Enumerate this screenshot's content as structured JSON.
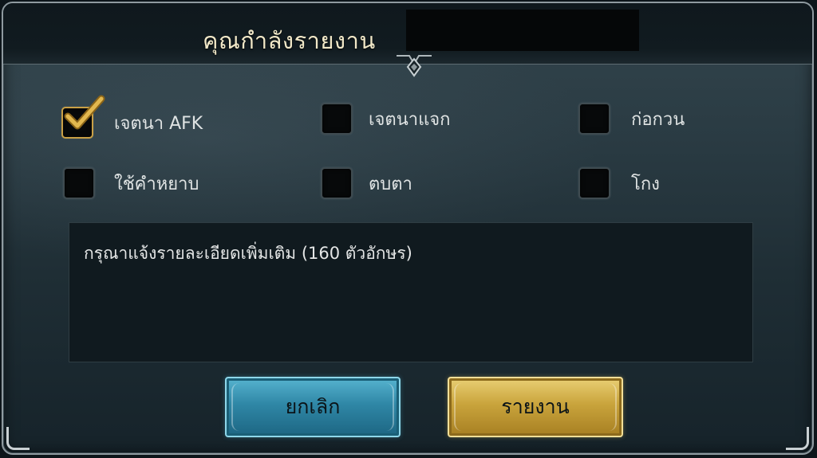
{
  "dialog": {
    "title": "คุณกำลังรายงาน"
  },
  "reasons": [
    {
      "label": "เจตนา AFK",
      "checked": true
    },
    {
      "label": "เจตนาแจก",
      "checked": false
    },
    {
      "label": "ก่อกวน",
      "checked": false
    },
    {
      "label": "ใช้คำหยาบ",
      "checked": false
    },
    {
      "label": "ตบตา",
      "checked": false
    },
    {
      "label": "โกง",
      "checked": false
    }
  ],
  "details": {
    "placeholder": "กรุณาแจ้งรายละเอียดเพิ่มเติม (160 ตัวอักษร)",
    "value": ""
  },
  "buttons": {
    "cancel_label": "ยกเลิก",
    "report_label": "รายงาน"
  },
  "colors": {
    "accent_gold": "#c9a046",
    "cancel_blue": "#2f87a6",
    "title_text": "#f1e8c8"
  }
}
